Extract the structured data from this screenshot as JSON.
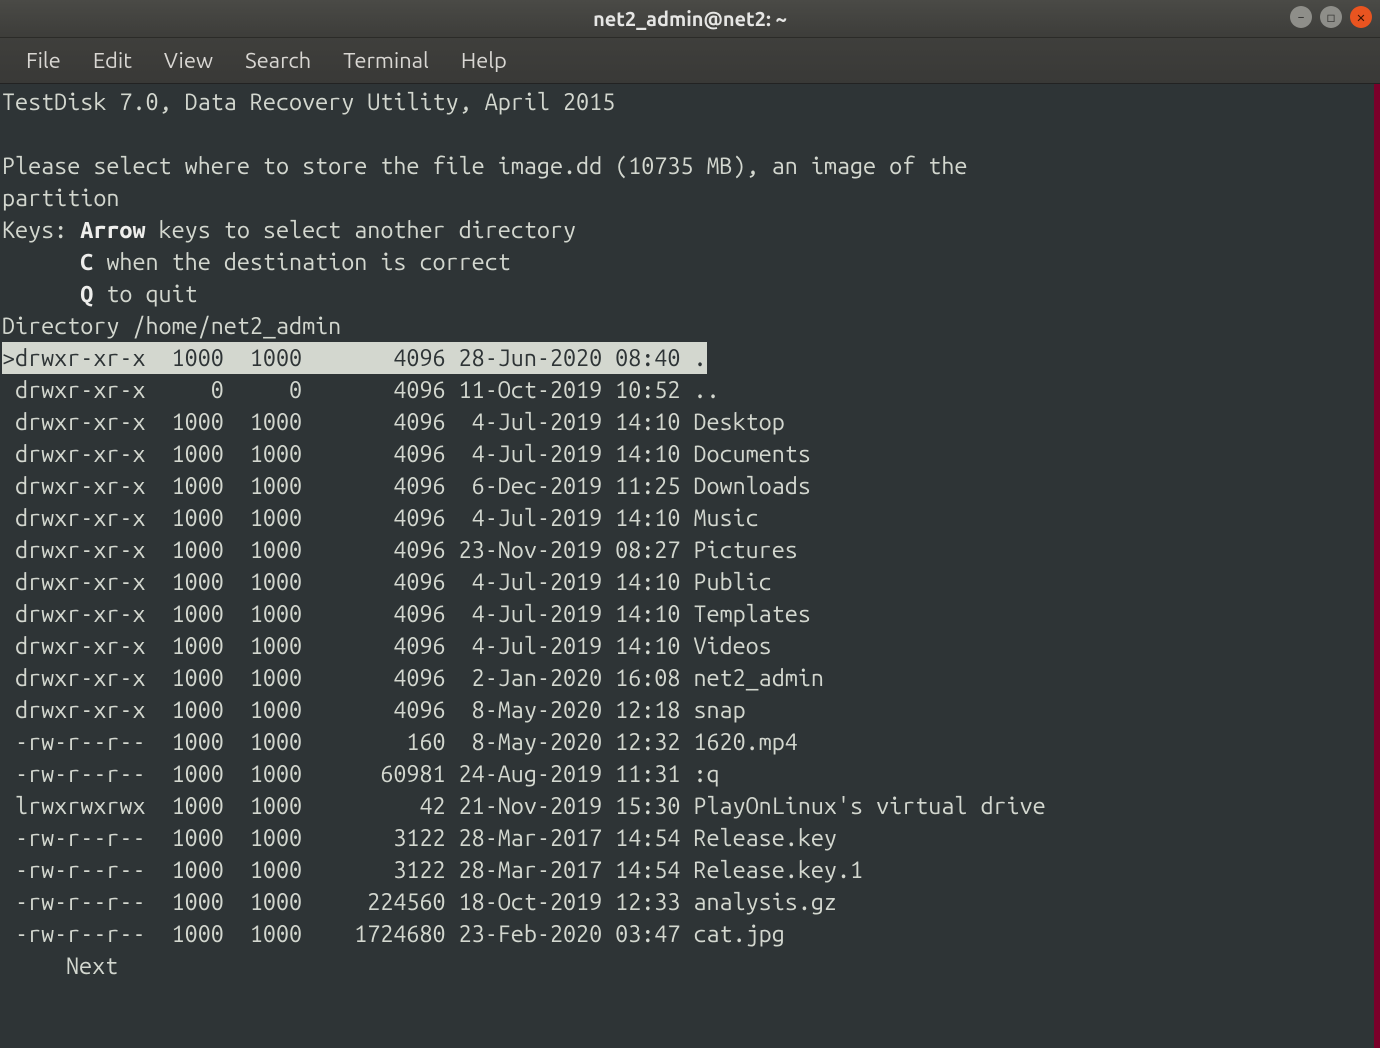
{
  "titlebar": {
    "title": "net2_admin@net2: ~"
  },
  "menu": {
    "file": "File",
    "edit": "Edit",
    "view": "View",
    "search": "Search",
    "terminal": "Terminal",
    "help": "Help"
  },
  "status": {
    "app_line": "TestDisk 7.0, Data Recovery Utility, April 2015",
    "prompt_line": "Please select where to store the file image.dd (10735 MB), an image of the partition",
    "keys_label": "Keys: ",
    "arrow_bold": "Arrow",
    "arrow_rest": " keys to select another directory",
    "c_bold": "C",
    "c_rest": " when the destination is correct",
    "q_bold": "Q",
    "q_rest": " to quit",
    "dir_line": "Directory /home/net2_admin"
  },
  "rows": [
    {
      "cursor": ">",
      "perm": "drwxr-xr-x",
      "uid": "1000",
      "gid": "1000",
      "size": "4096",
      "date": "28-Jun-2020",
      "time": "08:40",
      "name": ".",
      "selected": true
    },
    {
      "cursor": " ",
      "perm": "drwxr-xr-x",
      "uid": "0",
      "gid": "0",
      "size": "4096",
      "date": "11-Oct-2019",
      "time": "10:52",
      "name": "..",
      "selected": false
    },
    {
      "cursor": " ",
      "perm": "drwxr-xr-x",
      "uid": "1000",
      "gid": "1000",
      "size": "4096",
      "date": " 4-Jul-2019",
      "time": "14:10",
      "name": "Desktop",
      "selected": false
    },
    {
      "cursor": " ",
      "perm": "drwxr-xr-x",
      "uid": "1000",
      "gid": "1000",
      "size": "4096",
      "date": " 4-Jul-2019",
      "time": "14:10",
      "name": "Documents",
      "selected": false
    },
    {
      "cursor": " ",
      "perm": "drwxr-xr-x",
      "uid": "1000",
      "gid": "1000",
      "size": "4096",
      "date": " 6-Dec-2019",
      "time": "11:25",
      "name": "Downloads",
      "selected": false
    },
    {
      "cursor": " ",
      "perm": "drwxr-xr-x",
      "uid": "1000",
      "gid": "1000",
      "size": "4096",
      "date": " 4-Jul-2019",
      "time": "14:10",
      "name": "Music",
      "selected": false
    },
    {
      "cursor": " ",
      "perm": "drwxr-xr-x",
      "uid": "1000",
      "gid": "1000",
      "size": "4096",
      "date": "23-Nov-2019",
      "time": "08:27",
      "name": "Pictures",
      "selected": false
    },
    {
      "cursor": " ",
      "perm": "drwxr-xr-x",
      "uid": "1000",
      "gid": "1000",
      "size": "4096",
      "date": " 4-Jul-2019",
      "time": "14:10",
      "name": "Public",
      "selected": false
    },
    {
      "cursor": " ",
      "perm": "drwxr-xr-x",
      "uid": "1000",
      "gid": "1000",
      "size": "4096",
      "date": " 4-Jul-2019",
      "time": "14:10",
      "name": "Templates",
      "selected": false
    },
    {
      "cursor": " ",
      "perm": "drwxr-xr-x",
      "uid": "1000",
      "gid": "1000",
      "size": "4096",
      "date": " 4-Jul-2019",
      "time": "14:10",
      "name": "Videos",
      "selected": false
    },
    {
      "cursor": " ",
      "perm": "drwxr-xr-x",
      "uid": "1000",
      "gid": "1000",
      "size": "4096",
      "date": " 2-Jan-2020",
      "time": "16:08",
      "name": "net2_admin",
      "selected": false
    },
    {
      "cursor": " ",
      "perm": "drwxr-xr-x",
      "uid": "1000",
      "gid": "1000",
      "size": "4096",
      "date": " 8-May-2020",
      "time": "12:18",
      "name": "snap",
      "selected": false
    },
    {
      "cursor": " ",
      "perm": "-rw-r--r--",
      "uid": "1000",
      "gid": "1000",
      "size": "160",
      "date": " 8-May-2020",
      "time": "12:32",
      "name": "1620.mp4",
      "selected": false
    },
    {
      "cursor": " ",
      "perm": "-rw-r--r--",
      "uid": "1000",
      "gid": "1000",
      "size": "60981",
      "date": "24-Aug-2019",
      "time": "11:31",
      "name": ":q",
      "selected": false
    },
    {
      "cursor": " ",
      "perm": "lrwxrwxrwx",
      "uid": "1000",
      "gid": "1000",
      "size": "42",
      "date": "21-Nov-2019",
      "time": "15:30",
      "name": "PlayOnLinux's virtual drive",
      "selected": false
    },
    {
      "cursor": " ",
      "perm": "-rw-r--r--",
      "uid": "1000",
      "gid": "1000",
      "size": "3122",
      "date": "28-Mar-2017",
      "time": "14:54",
      "name": "Release.key",
      "selected": false
    },
    {
      "cursor": " ",
      "perm": "-rw-r--r--",
      "uid": "1000",
      "gid": "1000",
      "size": "3122",
      "date": "28-Mar-2017",
      "time": "14:54",
      "name": "Release.key.1",
      "selected": false
    },
    {
      "cursor": " ",
      "perm": "-rw-r--r--",
      "uid": "1000",
      "gid": "1000",
      "size": "224560",
      "date": "18-Oct-2019",
      "time": "12:33",
      "name": "analysis.gz",
      "selected": false
    },
    {
      "cursor": " ",
      "perm": "-rw-r--r--",
      "uid": "1000",
      "gid": "1000",
      "size": "1724680",
      "date": "23-Feb-2020",
      "time": "03:47",
      "name": "cat.jpg",
      "selected": false
    }
  ],
  "footer": {
    "next": "Next"
  }
}
